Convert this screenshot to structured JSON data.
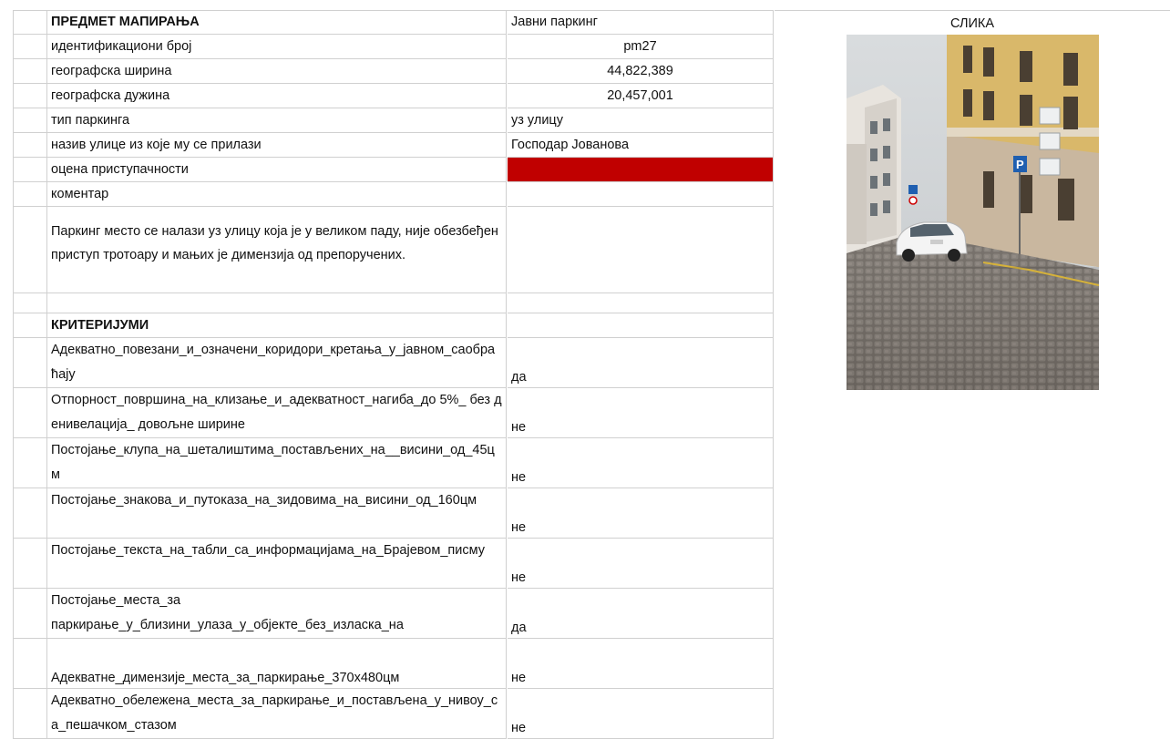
{
  "header": {
    "title": "ПРЕДМЕТ МАПИРАЊА",
    "value": "Јавни паркинг",
    "image_header": "СЛИКА"
  },
  "fields": {
    "id_label": "идентификациони број",
    "id_value": "pm27",
    "lat_label": "географска ширина",
    "lat_value": "44,822,389",
    "lon_label": "географска дужина",
    "lon_value": "20,457,001",
    "type_label": "тип паркинга",
    "type_value": "уз улицу",
    "street_label": "назив улице из које му се прилази",
    "street_value": "Господар Јованова",
    "rating_label": "оцена приступачности",
    "rating_color": "#c00000",
    "comment_label": "коментар",
    "comment_text": "Паркинг место се налази уз улицу која је у великом паду, није обезбеђен приступ тротоару и мањих је димензија од препоручених."
  },
  "criteria": {
    "heading": "КРИТЕРИЈУМИ",
    "items": [
      {
        "label": "Адекватно_повезани_и_означени_коридори_кретања_у_јавном_саобраћају",
        "value": "да"
      },
      {
        "label": "Отпорност_површина_на_клизање_и_адекватност_нагиба_до 5%_ без денивелација_ довољне ширине",
        "value": "не"
      },
      {
        "label": "Постојање_клупа_на_шеталиштима_постављених_на__висини_од_45цм",
        "value": "не"
      },
      {
        "label": "Постојање_знакова_и_путоказа_на_зидовима_на_висини_од_160цм",
        "value": "не"
      },
      {
        "label": "Постојање_текста_на_табли_са_информацијама_на_Брајевом_писму",
        "value": "не"
      },
      {
        "label_line1": "Постојање_места_за",
        "label_line2": "паркирање_у_близини_улаза_у_објекте_без_изласка_на",
        "value": "да"
      },
      {
        "label": "Адекватне_димензије_места_за_паркирање_370х480цм",
        "value": "не"
      },
      {
        "label": "Адекватно_обележена_места_за_паркирање_и_постављена_у_нивоу_са_пешачком_стазом",
        "value": "не"
      }
    ]
  }
}
